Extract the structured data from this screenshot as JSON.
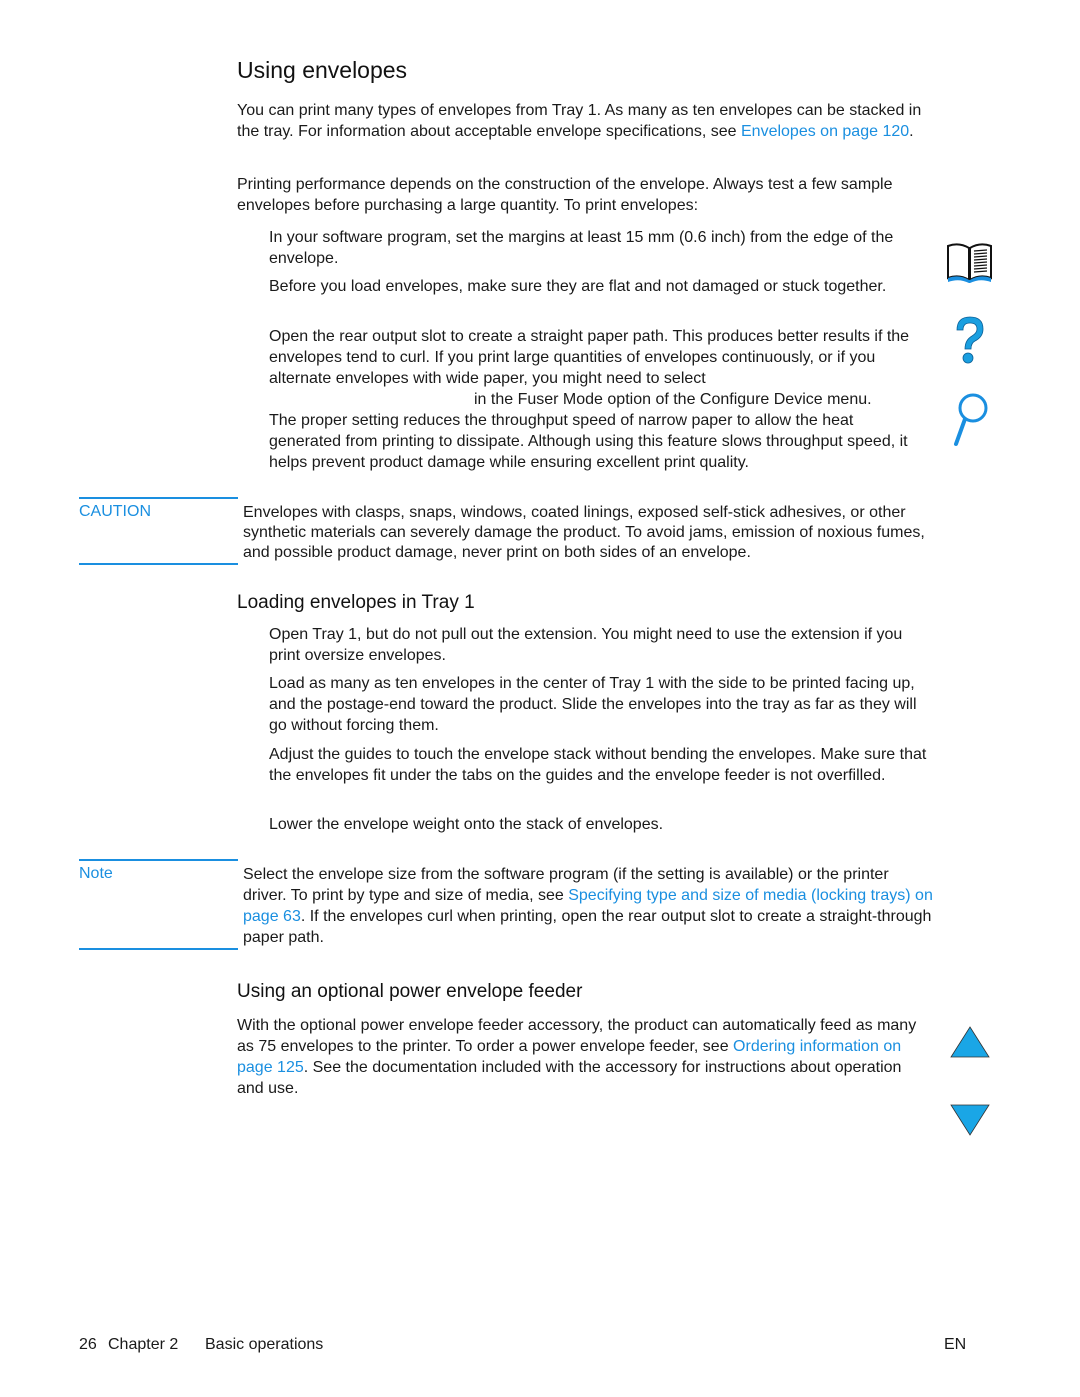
{
  "page": {
    "title": "Using envelopes",
    "intro": {
      "text": "You can print many types of envelopes from Tray 1. As many as ten envelopes can be stacked in the tray. For information about acceptable envelope specifications, see ",
      "link": "Envelopes  on page 120",
      "after": "."
    },
    "performance": "Printing performance depends on the construction of the envelope. Always test a few sample envelopes before purchasing a large quantity. To print envelopes:",
    "steps": [
      "In your software program, set the margins at least 15 mm (0.6 inch) from the edge of the envelope.",
      "Before you load envelopes, make sure they are flat and not damaged or stuck together.",
      "Open the rear output slot to create a straight paper path. This produces better results if the envelopes tend to curl. If you print large quantities of envelopes continuously, or if you alternate envelopes with wide paper, you might need to select",
      "in the Fuser Mode option of the Configure Device menu.",
      "The proper setting reduces the throughput speed of narrow paper to allow the heat generated from printing to dissipate. Although using this feature slows throughput speed, it helps prevent product damage while ensuring excellent print quality."
    ],
    "caution": {
      "label": "CAUTION",
      "text": "Envelopes with clasps, snaps, windows, coated linings, exposed self-stick adhesives, or other synthetic materials can severely damage the product. To avoid jams, emission of noxious fumes, and possible product damage, never print on both sides of an envelope."
    },
    "loading": {
      "heading": "Loading envelopes in Tray 1",
      "steps": [
        "Open Tray 1, but do not pull out the extension. You might need to use the extension if you print oversize envelopes.",
        "Load as many as ten envelopes in the center of Tray 1 with the side to be printed facing up, and the postage-end toward the product. Slide the envelopes into the tray as far as they will go without forcing them.",
        "Adjust the guides to touch the envelope stack without bending the envelopes. Make sure that the envelopes fit under the tabs on the guides and the envelope feeder is not overfilled.",
        "Lower the envelope weight onto the stack of envelopes."
      ]
    },
    "note": {
      "label": "Note",
      "text_before": "Select the envelope size from the software program (if the setting is available) or the printer driver. To print by type and size of media, see ",
      "link": "Specifying type and size of media (locking trays)  on page 63",
      "text_after": ". If the envelopes curl when printing, open the rear output slot to create a straight-through paper path."
    },
    "feeder": {
      "heading": "Using an optional power envelope feeder",
      "text_before": "With the optional power envelope feeder accessory, the product can automatically feed as many as 75 envelopes to the printer. To order a power envelope feeder, see ",
      "link": "Ordering information  on page 125",
      "text_after": ". See the documentation included with the accessory for instructions about operation and use."
    },
    "footer": {
      "page_number": "26",
      "chapter": "Chapter 2",
      "section": "Basic operations",
      "lang": "EN"
    }
  },
  "icons": {
    "contents": "book-icon",
    "help": "question-icon",
    "index": "magnifier-icon",
    "prev": "triangle-up-icon",
    "next": "triangle-down-icon"
  },
  "colors": {
    "accent": "#1a8fe0",
    "text": "#1a1a1a"
  }
}
